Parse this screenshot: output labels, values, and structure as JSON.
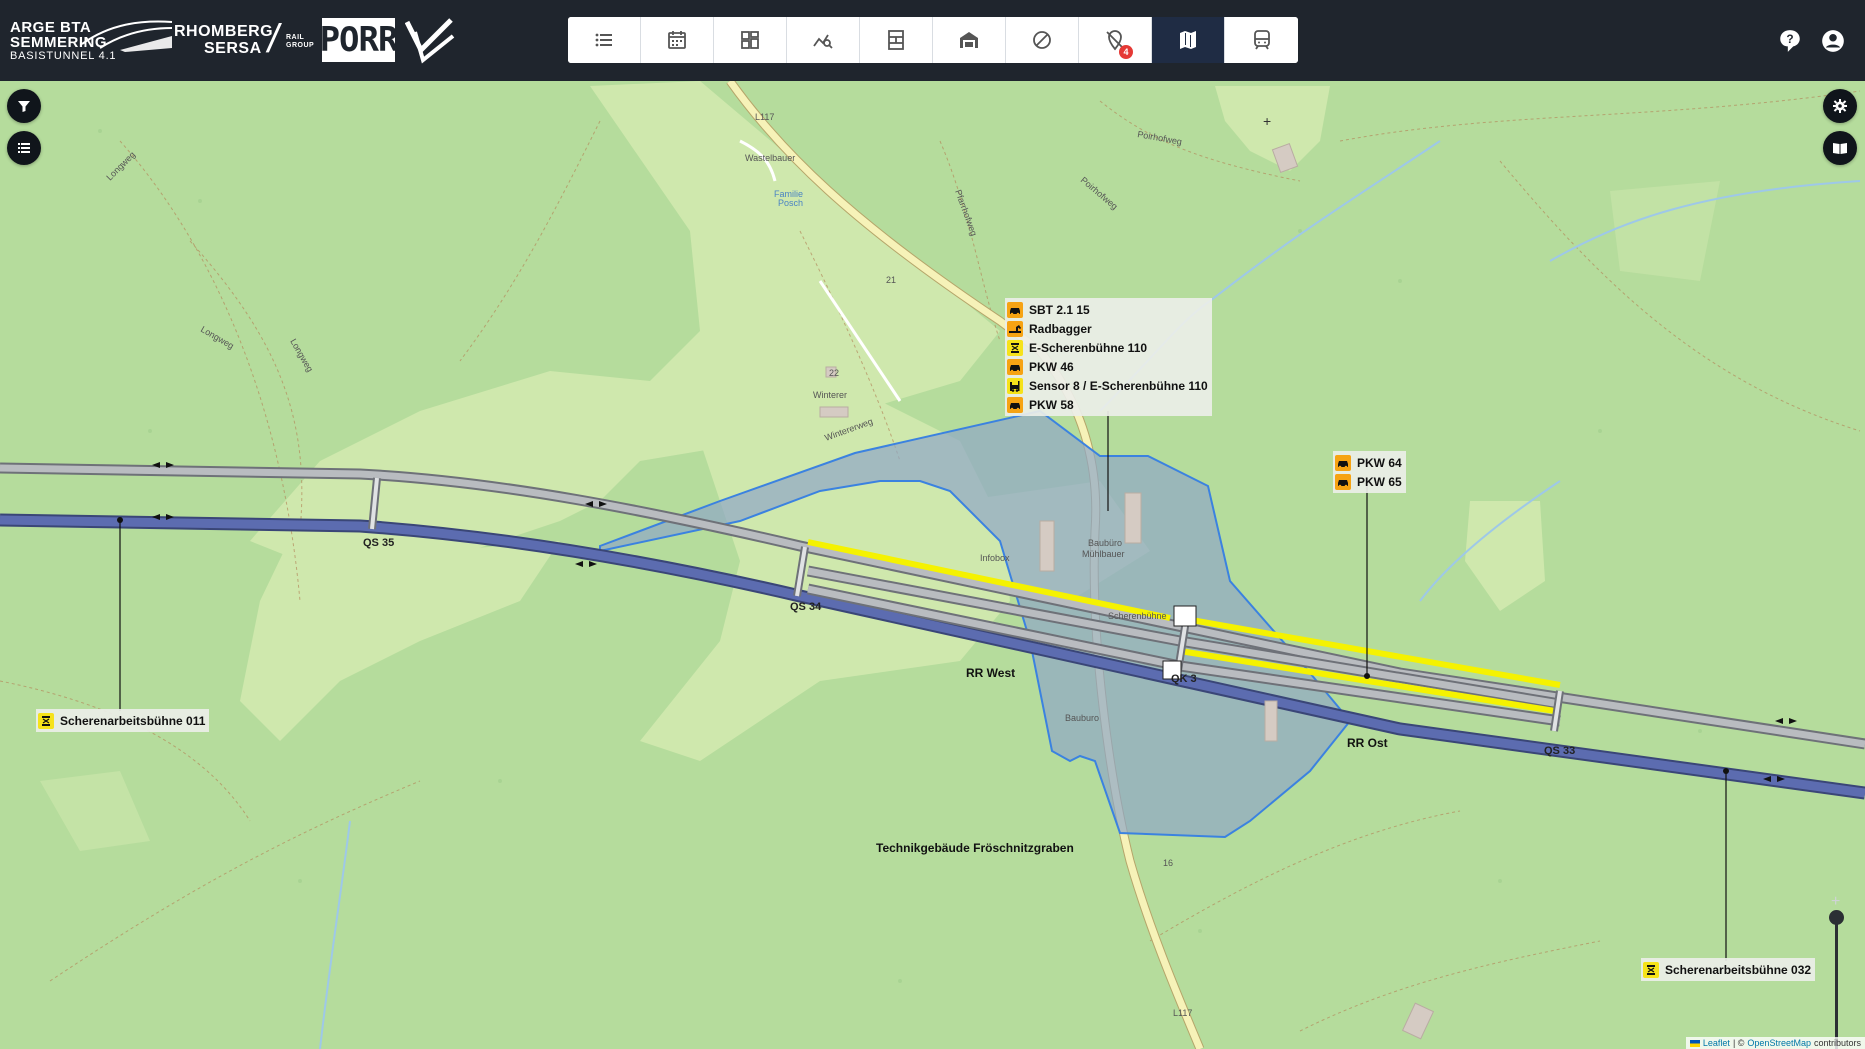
{
  "header": {
    "arge_line1": "ARGE BTA",
    "arge_line2": "SEMMERING",
    "arge_line3": "BASISTUNNEL 4.1",
    "rhomberg_line1": "RHOMBERG",
    "rhomberg_line2": "SERSA",
    "rail_group_line1": "RAIL",
    "rail_group_line2": "GROUP",
    "porr_logo": "PORR",
    "toolbar": [
      {
        "icon": "list-icon"
      },
      {
        "icon": "calendar-icon"
      },
      {
        "icon": "dashboard-icon"
      },
      {
        "icon": "analytics-search-icon"
      },
      {
        "icon": "schedule-board-icon"
      },
      {
        "icon": "garage-icon"
      },
      {
        "icon": "blocked-icon"
      },
      {
        "icon": "location-off-icon",
        "badge": "4"
      },
      {
        "icon": "map-icon",
        "active": true
      },
      {
        "icon": "train-icon"
      }
    ],
    "help_icon": "help-icon",
    "account_icon": "account-icon"
  },
  "map": {
    "controls_left": [
      "filter-icon",
      "layer-list-icon"
    ],
    "controls_right": [
      "settings-icon",
      "book-icon"
    ],
    "popup_main": [
      {
        "label": "SBT 2.1 15",
        "icon": "car-icon",
        "color": "orange"
      },
      {
        "label": "Radbagger",
        "icon": "excavator-icon",
        "color": "orange"
      },
      {
        "label": "E-Scherenbühne 110",
        "icon": "lift-icon",
        "color": "yellow"
      },
      {
        "label": "PKW 46",
        "icon": "car-icon",
        "color": "orange"
      },
      {
        "label": "Sensor 8 / E-Scherenbühne 110",
        "icon": "forklift-icon",
        "color": "yellow"
      },
      {
        "label": "PKW 58",
        "icon": "car-icon",
        "color": "orange"
      }
    ],
    "popup_pkw": [
      {
        "label": "PKW 64",
        "icon": "car-icon",
        "color": "orange"
      },
      {
        "label": "PKW 65",
        "icon": "car-icon",
        "color": "orange"
      }
    ],
    "marker_left": {
      "label": "Scherenarbeitsbühne 011",
      "icon": "lift-icon",
      "color": "yellow"
    },
    "marker_right": {
      "label": "Scherenarbeitsbühne 032",
      "icon": "lift-icon",
      "color": "yellow"
    },
    "labels": {
      "rr_west": "RR West",
      "rr_ost": "RR Ost",
      "technik": "Technikgebäude Fröschnitzgraben",
      "qs35": "QS 35",
      "qs34": "QS 34",
      "qs33": "QS 33",
      "qk3": "QK 3"
    },
    "osm_labels": {
      "l117_top": "L117",
      "l117_bottom": "L117",
      "wastelbauer": "Wastelbauer",
      "familie": "Familie",
      "posch": "Posch",
      "winterer": "Winterer",
      "wintererweg": "Wintererweg",
      "longweg_a": "Longweg",
      "longweg_b": "Longweg",
      "longweg_c": "Longweg",
      "pfarrhofweg": "Pfarrhofweg",
      "poirhofweg": "Poirhofweg",
      "poirhof": "Poirhofweg",
      "baubuero": "Baubüro",
      "muehlbauer": "Mühlbauer",
      "infobox": "Infobox",
      "sinter": "Scherenbühne",
      "bauburo2": "Bauburo",
      "num21": "21",
      "num22": "22",
      "num16": "16"
    },
    "attribution": {
      "leaflet": "Leaflet",
      "sep": "| ©",
      "osm": "OpenStreetMap",
      "contributors": "contributors"
    },
    "colors": {
      "background": "#c8e2a2",
      "forest": "#a9d597",
      "meadow": "#cfe8ad",
      "tunnel_blue": "#4a5a9a",
      "tunnel_grey": "#9a9ea4",
      "highlight_yellow": "#f5f200",
      "zone_fill": "#93a9c6",
      "zone_stroke": "#3b82e0",
      "road": "#f6f2b8"
    }
  }
}
